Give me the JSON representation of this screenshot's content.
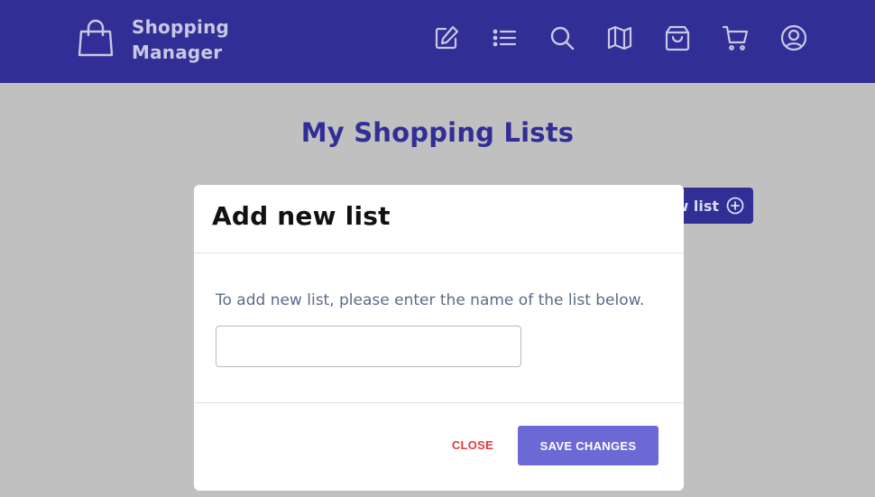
{
  "app": {
    "brand_line1": "Shopping",
    "brand_line2": "Manager"
  },
  "nav": {
    "icons": [
      "edit-icon",
      "list-icon",
      "search-icon",
      "map-icon",
      "bag-icon",
      "cart-icon",
      "user-icon"
    ]
  },
  "page": {
    "title": "My Shopping Lists",
    "add_button_label": "New list"
  },
  "modal": {
    "title": "Add new list",
    "description": "To add new list, please enter the name of the list below.",
    "input_value": "",
    "input_placeholder": "",
    "close_label": "CLOSE",
    "save_label": "SAVE CHANGES"
  },
  "colors": {
    "header_bg": "#312e96",
    "overlay_bg": "#c0c0c0",
    "accent": "#6c68d6",
    "danger": "#e53a3a"
  }
}
